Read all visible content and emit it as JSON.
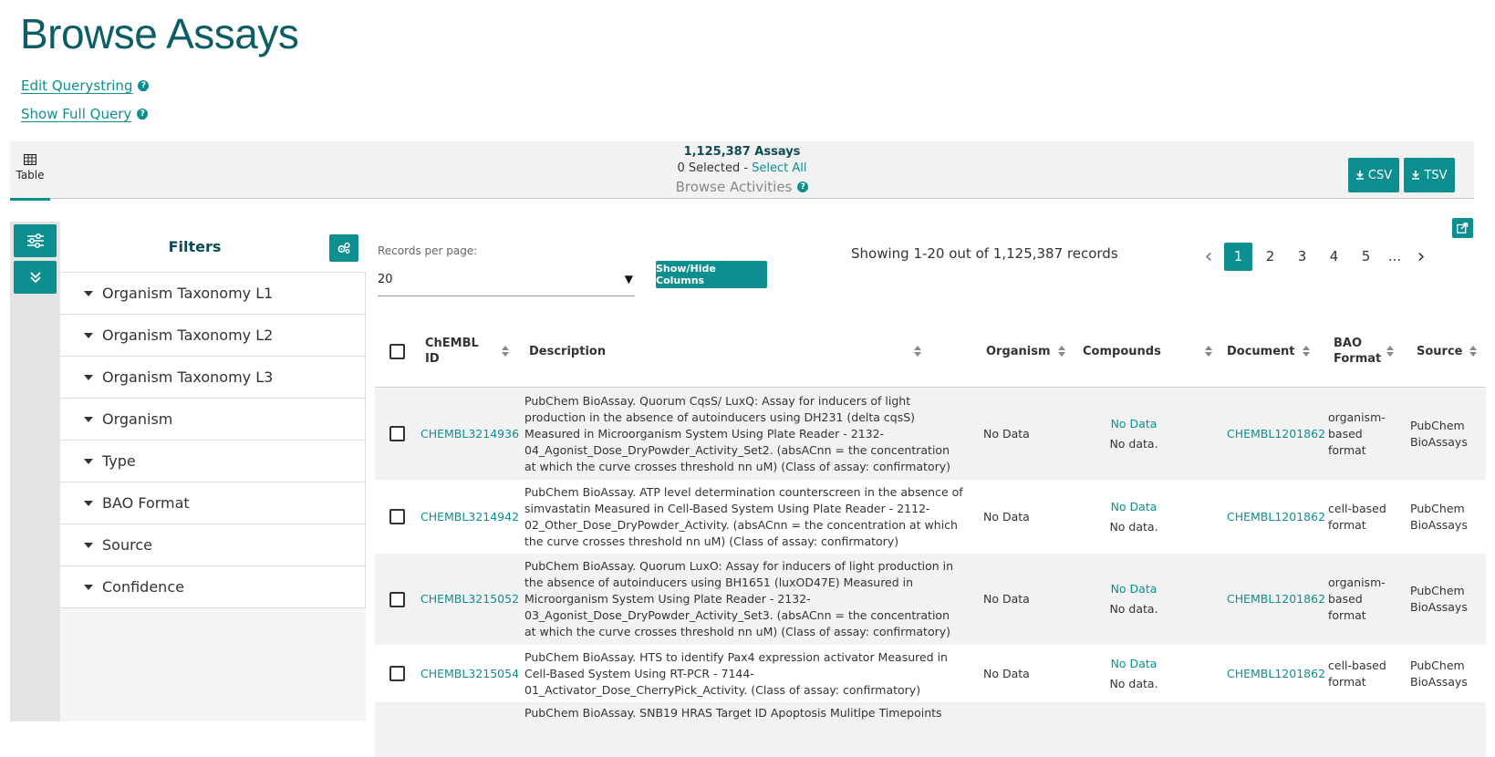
{
  "page": {
    "title": "Browse Assays",
    "links": {
      "edit_querystring": "Edit Querystring",
      "show_full_query": "Show Full Query"
    }
  },
  "summary": {
    "view_tab": "Table",
    "count": "1,125,387 Assays",
    "selected": "0 Selected - ",
    "select_all": "Select All",
    "browse_activities": "Browse Activities",
    "csv": "CSV",
    "tsv": "TSV"
  },
  "filters": {
    "title": "Filters",
    "items": [
      "Organism Taxonomy L1",
      "Organism Taxonomy L2",
      "Organism Taxonomy L3",
      "Organism",
      "Type",
      "BAO Format",
      "Source",
      "Confidence"
    ]
  },
  "controls": {
    "rpp_label": "Records per page:",
    "rpp_value": "20",
    "show_hide": "Show/Hide Columns",
    "showing": "Showing 1-20 out of 1,125,387 records"
  },
  "pagination": {
    "pages": [
      "1",
      "2",
      "3",
      "4",
      "5"
    ],
    "current": "1",
    "ellipsis": "..."
  },
  "table": {
    "headers": {
      "chembl_id": "ChEMBL ID",
      "description": "Description",
      "organism": "Organism",
      "compounds": "Compounds",
      "document": "Document",
      "bao_format": "BAO Format",
      "source": "Source"
    },
    "rows": [
      {
        "id": "CHEMBL3214936",
        "description": "PubChem BioAssay. Quorum CqsS/ LuxQ: Assay for inducers of light production in the absence of autoinducers using DH231 (delta cqsS) Measured in Microorganism System Using Plate Reader - 2132-04_Agonist_Dose_DryPowder_Activity_Set2. (absACnn = the concentration at which the curve crosses threshold nn uM) (Class of assay: confirmatory)",
        "organism": "No Data",
        "compounds_link": "No Data",
        "compounds_text": "No data.",
        "document": "CHEMBL1201862",
        "bao_format": "organism-based format",
        "source": "PubChem BioAssays"
      },
      {
        "id": "CHEMBL3214942",
        "description": "PubChem BioAssay. ATP level determination counterscreen in the absence of simvastatin Measured in Cell-Based System Using Plate Reader - 2112-02_Other_Dose_DryPowder_Activity. (absACnn = the concentration at which the curve crosses threshold nn uM) (Class of assay: confirmatory)",
        "organism": "No Data",
        "compounds_link": "No Data",
        "compounds_text": "No data.",
        "document": "CHEMBL1201862",
        "bao_format": "cell-based format",
        "source": "PubChem BioAssays"
      },
      {
        "id": "CHEMBL3215052",
        "description": "PubChem BioAssay. Quorum LuxO: Assay for inducers of light production in the absence of autoinducers using BH1651 (luxOD47E) Measured in Microorganism System Using Plate Reader - 2132-03_Agonist_Dose_DryPowder_Activity_Set3. (absACnn = the concentration at which the curve crosses threshold nn uM) (Class of assay: confirmatory)",
        "organism": "No Data",
        "compounds_link": "No Data",
        "compounds_text": "No data.",
        "document": "CHEMBL1201862",
        "bao_format": "organism-based format",
        "source": "PubChem BioAssays"
      },
      {
        "id": "CHEMBL3215054",
        "description": "PubChem BioAssay. HTS to identify Pax4 expression activator Measured in Cell-Based System Using RT-PCR - 7144-01_Activator_Dose_CherryPick_Activity. (Class of assay: confirmatory)",
        "organism": "No Data",
        "compounds_link": "No Data",
        "compounds_text": "No data.",
        "document": "CHEMBL1201862",
        "bao_format": "cell-based format",
        "source": "PubChem BioAssays"
      },
      {
        "id": "",
        "description": "PubChem BioAssay. SNB19 HRAS Target ID Apoptosis Mulitlpe Timepoints",
        "organism": "",
        "compounds_link": "",
        "compounds_text": "",
        "document": "",
        "bao_format": "",
        "source": ""
      }
    ]
  },
  "colors": {
    "accent": "#0e8f8f",
    "title": "#0d5d66",
    "row_alt": "#f2f2f2"
  }
}
